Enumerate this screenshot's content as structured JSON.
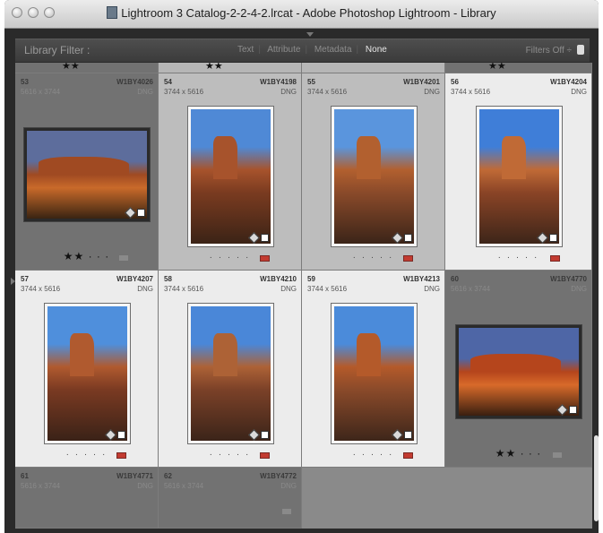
{
  "window": {
    "title": "Lightroom 3 Catalog-2-2-4-2.lrcat - Adobe Photoshop Lightroom - Library"
  },
  "filter_bar": {
    "label": "Library Filter :",
    "tabs": [
      {
        "label": "Text",
        "active": false
      },
      {
        "label": "Attribute",
        "active": false
      },
      {
        "label": "Metadata",
        "active": false
      },
      {
        "label": "None",
        "active": true
      }
    ],
    "filters_status": "Filters Off ÷"
  },
  "top_row_ratings": [
    "★★",
    "★★",
    "★★"
  ],
  "cells": [
    {
      "num": "53",
      "code": "W1BY4026",
      "dims": "5616 x 3744",
      "fmt": "DNG",
      "rating": "★★ · · ·",
      "label": "none",
      "state": "dim",
      "orientation": "landscape",
      "palette": [
        "#5d6d9c",
        "#a04a22",
        "#c96a2a",
        "#3a2412"
      ]
    },
    {
      "num": "54",
      "code": "W1BY4198",
      "dims": "3744 x 5616",
      "fmt": "DNG",
      "rating": "· · · · ·",
      "label": "red",
      "state": "normal",
      "orientation": "portrait",
      "palette": [
        "#4f89d6",
        "#a7532c",
        "#7a3b20",
        "#3b2316"
      ]
    },
    {
      "num": "55",
      "code": "W1BY4201",
      "dims": "3744 x 5616",
      "fmt": "DNG",
      "rating": "· · · · ·",
      "label": "red",
      "state": "normal",
      "orientation": "portrait",
      "palette": [
        "#5a95dd",
        "#b2602f",
        "#8a4a2a",
        "#3b2418"
      ]
    },
    {
      "num": "56",
      "code": "W1BY4204",
      "dims": "3744 x 5616",
      "fmt": "DNG",
      "rating": "· · · · ·",
      "label": "red",
      "state": "sel",
      "orientation": "portrait",
      "palette": [
        "#3f7ed8",
        "#c06a36",
        "#8a4426",
        "#3d2519"
      ]
    },
    {
      "num": "57",
      "code": "W1BY4207",
      "dims": "3744 x 5616",
      "fmt": "DNG",
      "rating": "· · · · ·",
      "label": "red",
      "state": "sel",
      "orientation": "portrait",
      "palette": [
        "#4f8fdc",
        "#b05a2f",
        "#7a3a22",
        "#3a2217"
      ]
    },
    {
      "num": "58",
      "code": "W1BY4210",
      "dims": "3744 x 5616",
      "fmt": "DNG",
      "rating": "· · · · ·",
      "label": "red",
      "state": "sel",
      "orientation": "portrait",
      "palette": [
        "#4a87d8",
        "#ad6236",
        "#7b4128",
        "#3b2419"
      ]
    },
    {
      "num": "59",
      "code": "W1BY4213",
      "dims": "3744 x 5616",
      "fmt": "DNG",
      "rating": "· · · · ·",
      "label": "red",
      "state": "sel",
      "orientation": "portrait",
      "palette": [
        "#4b8bda",
        "#b45a2a",
        "#8a4a2a",
        "#3e261a"
      ]
    },
    {
      "num": "60",
      "code": "W1BY4770",
      "dims": "5616 x 3744",
      "fmt": "DNG",
      "rating": "★★ · · ·",
      "label": "none",
      "state": "dim",
      "orientation": "landscape",
      "palette": [
        "#4e66a6",
        "#b5451c",
        "#d86a2a",
        "#3a1f10"
      ]
    },
    {
      "num": "61",
      "code": "W1BY4771",
      "dims": "5616 x 3744",
      "fmt": "DNG",
      "rating": "",
      "label": "none",
      "state": "dim",
      "orientation": "none",
      "palette": []
    },
    {
      "num": "62",
      "code": "W1BY4772",
      "dims": "5616 x 3744",
      "fmt": "DNG",
      "rating": "",
      "label": "none",
      "state": "dim",
      "orientation": "none",
      "palette": []
    }
  ]
}
